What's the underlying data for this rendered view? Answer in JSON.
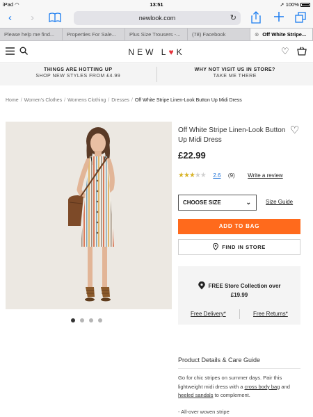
{
  "status_bar": {
    "device": "iPad",
    "time": "13:51",
    "battery": "100%"
  },
  "browser": {
    "url": "newlook.com",
    "tabs": [
      {
        "label": "Please help me find...",
        "active": false
      },
      {
        "label": "Properties For Sale...",
        "active": false
      },
      {
        "label": "Plus Size Trousers -...",
        "active": false
      },
      {
        "label": "(78) Facebook",
        "active": false
      },
      {
        "label": "Off White Stripe...",
        "active": true
      }
    ]
  },
  "site": {
    "logo_left": "NEW L",
    "logo_heart": "♥",
    "logo_right": "K"
  },
  "promo": {
    "left_title": "THINGS ARE HOTTING UP",
    "left_sub": "SHOP NEW STYLES FROM £4.99",
    "right_title": "WHY NOT VISIT US IN STORE?",
    "right_sub": "TAKE ME THERE"
  },
  "breadcrumb": [
    "Home",
    "Women's Clothes",
    "Womens Clothing",
    "Dresses",
    "Off White Stripe Linen-Look Button Up Midi Dress"
  ],
  "product": {
    "title": "Off White Stripe Linen-Look Button Up Midi Dress",
    "price": "£22.99",
    "rating_value": "2.6",
    "rating_stars": 2.6,
    "review_count": "(9)",
    "write_review": "Write a review",
    "size_select": "CHOOSE SIZE",
    "size_guide": "Size Guide",
    "add_to_bag": "ADD TO BAG",
    "find_in_store": "FIND IN STORE",
    "carousel_total": 4,
    "carousel_active": 1
  },
  "collection": {
    "line": "FREE Store Collection over",
    "threshold": "£19.99",
    "free_delivery": "Free Delivery*",
    "free_returns": "Free Returns*"
  },
  "details": {
    "heading": "Product Details & Care Guide",
    "text_1": "Go for chic stripes on summer days. Pair this lightweight midi dress with a ",
    "link_1": "cross body bag",
    "text_2": " and ",
    "link_2": "heeled sandals",
    "text_3": " to complement.",
    "bullet_1": "- All-over woven stripe"
  },
  "colors": {
    "accent_orange": "#ff6a1c",
    "ios_blue": "#1a7cf0",
    "star_gold": "#d8b327"
  }
}
